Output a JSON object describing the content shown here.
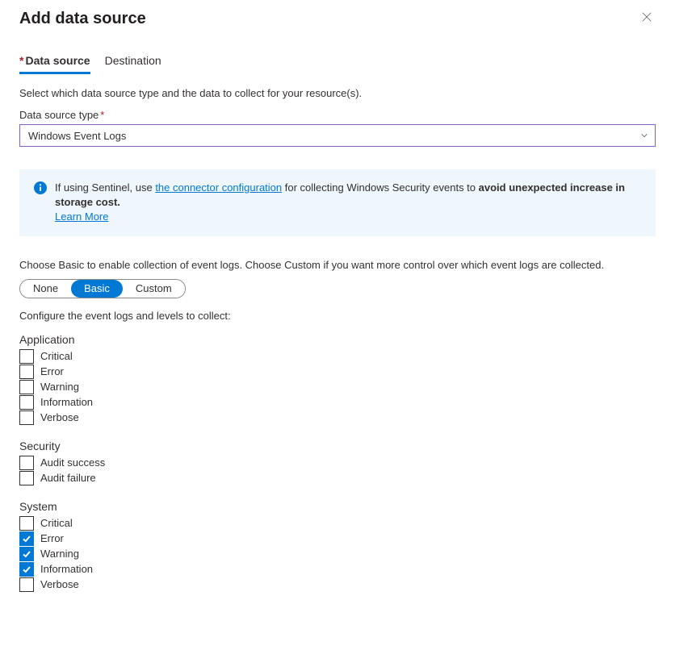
{
  "title": "Add data source",
  "tabs": {
    "data_source": "Data source",
    "destination": "Destination"
  },
  "intro": "Select which data source type and the data to collect for your resource(s).",
  "field": {
    "label": "Data source type",
    "value": "Windows Event Logs"
  },
  "info": {
    "prefix": "If using Sentinel, use ",
    "link1": "the connector configuration",
    "mid": " for collecting Windows Security events to ",
    "bold": "avoid unexpected increase in storage cost.",
    "learn_more": "Learn More"
  },
  "choose_desc": "Choose Basic to enable collection of event logs. Choose Custom if you want more control over which event logs are collected.",
  "pills": {
    "none": "None",
    "basic": "Basic",
    "custom": "Custom"
  },
  "configure": "Configure the event logs and levels to collect:",
  "groups": {
    "application": {
      "label": "Application",
      "items": [
        {
          "label": "Critical",
          "checked": false
        },
        {
          "label": "Error",
          "checked": false
        },
        {
          "label": "Warning",
          "checked": false
        },
        {
          "label": "Information",
          "checked": false
        },
        {
          "label": "Verbose",
          "checked": false
        }
      ]
    },
    "security": {
      "label": "Security",
      "items": [
        {
          "label": "Audit success",
          "checked": false
        },
        {
          "label": "Audit failure",
          "checked": false
        }
      ]
    },
    "system": {
      "label": "System",
      "items": [
        {
          "label": "Critical",
          "checked": false
        },
        {
          "label": "Error",
          "checked": true
        },
        {
          "label": "Warning",
          "checked": true
        },
        {
          "label": "Information",
          "checked": true
        },
        {
          "label": "Verbose",
          "checked": false
        }
      ]
    }
  }
}
